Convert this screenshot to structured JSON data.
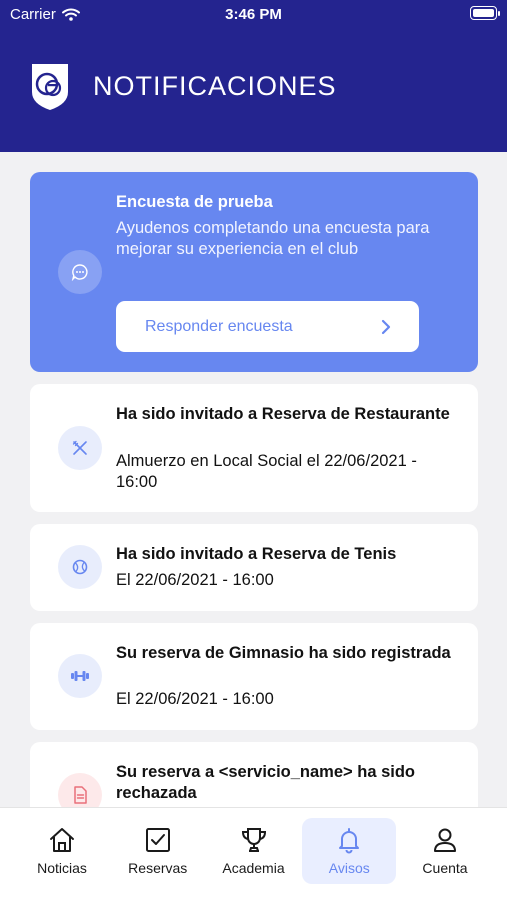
{
  "status_bar": {
    "carrier": "Carrier",
    "time": "3:46 PM"
  },
  "header": {
    "title": "NOTIFICACIONES"
  },
  "survey": {
    "title": "Encuesta de prueba",
    "body": "Ayudenos completando una encuesta para mejorar su experiencia en el club",
    "button_label": "Responder encuesta",
    "icon": "chat-bubble-icon"
  },
  "notifications": [
    {
      "title": "Ha sido invitado a Reserva de Restaurante",
      "body": "Almuerzo en Local Social el 22/06/2021 - 16:00",
      "icon": "utensils-icon"
    },
    {
      "title": "Ha sido invitado a Reserva de Tenis",
      "body": "El 22/06/2021 - 16:00",
      "icon": "tennis-ball-icon"
    },
    {
      "title": "Su reserva de Gimnasio ha sido registrada",
      "body": "El 22/06/2021 - 16:00",
      "icon": "dumbbell-icon"
    },
    {
      "title": "Su reserva a <servicio_name> ha sido rechazada",
      "body": "",
      "icon": "document-icon"
    }
  ],
  "tabbar": {
    "items": [
      {
        "label": "Noticias",
        "icon": "home-icon"
      },
      {
        "label": "Reservas",
        "icon": "checkbox-icon"
      },
      {
        "label": "Academia",
        "icon": "trophy-icon"
      },
      {
        "label": "Avisos",
        "icon": "bell-icon"
      },
      {
        "label": "Cuenta",
        "icon": "user-icon"
      }
    ],
    "active": "Avisos"
  },
  "colors": {
    "header_bg": "#24248f",
    "accent": "#6787f0",
    "background": "#f1f1f3",
    "alert": "#e9707a"
  }
}
